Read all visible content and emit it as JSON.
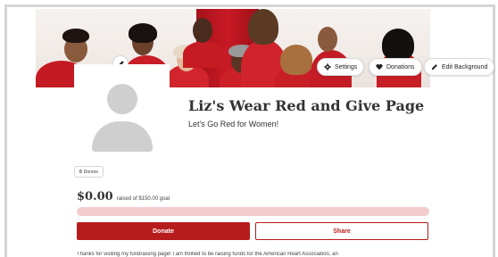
{
  "banner": {
    "edit_icon": "pencil-icon",
    "actions": [
      {
        "label": "Settings",
        "icon": "gear-icon"
      },
      {
        "label": "Donations",
        "icon": "heart-icon"
      },
      {
        "label": "Edit Background",
        "icon": "pencil-icon"
      }
    ]
  },
  "profile": {
    "title": "Liz's Wear Red and Give Page",
    "subtitle": "Let's Go Red for Women!"
  },
  "donors": {
    "count": "0",
    "label": "Donors"
  },
  "fundraising": {
    "amount": "$0.00",
    "raised_text": "raised of $150.00 goal",
    "progress_fraction": 0.0
  },
  "buttons": {
    "donate": "Donate",
    "share": "Share"
  },
  "description": "Thanks for visiting my fundraising page! I am thrilled to be raising funds for the American Heart Association, an",
  "colors": {
    "brand_red": "#b71c1c",
    "progress_track": "#f2cccd"
  }
}
